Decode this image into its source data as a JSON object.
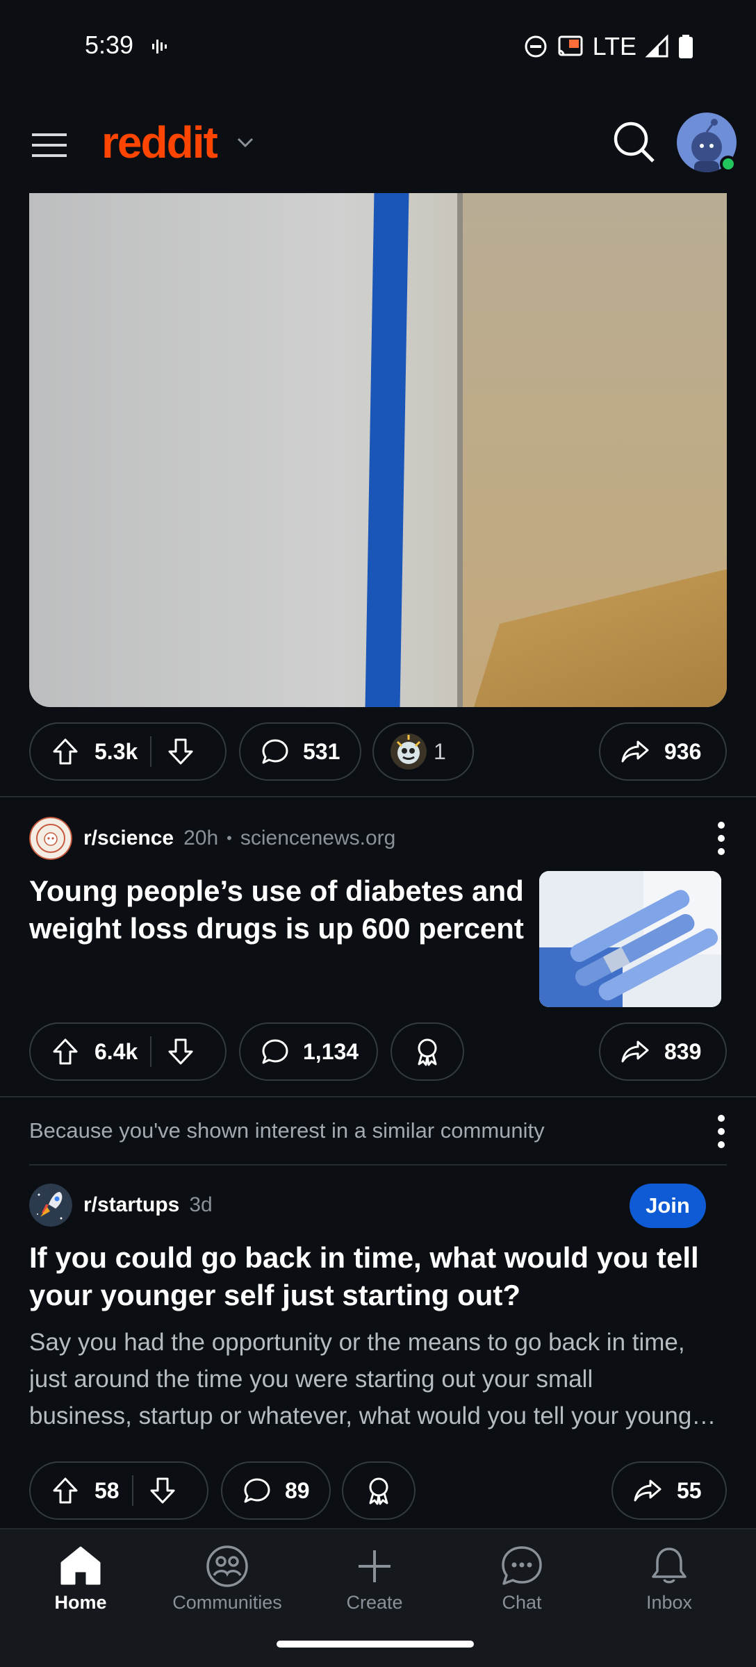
{
  "status_bar": {
    "time": "5:39",
    "network": "LTE"
  },
  "header": {
    "logo": "reddit"
  },
  "post1": {
    "upvotes": "5.3k",
    "comments": "531",
    "awards": "1",
    "shares": "936"
  },
  "post2": {
    "subreddit": "r/science",
    "age": "20h",
    "domain": "sciencenews.org",
    "title_lines": [
      "Young people’s use of diabetes and",
      "weight loss drugs is up 600 percent"
    ],
    "upvotes": "6.4k",
    "comments": "1,134",
    "shares": "839"
  },
  "recommendation": {
    "text": "Because you've shown interest in a similar community"
  },
  "post3": {
    "subreddit": "r/startups",
    "age": "3d",
    "join_label": "Join",
    "title_lines": [
      "If you could go back in time, what would you tell",
      "your younger self just starting out?"
    ],
    "body_lines": [
      "Say you had the opportunity or the means to go back in time,",
      "just around the time you were starting out your small",
      "business, startup or whatever, what would you tell your younger self"
    ],
    "upvotes": "58",
    "comments": "89",
    "shares": "55"
  },
  "bottom_nav": {
    "items": [
      {
        "label": "Home",
        "icon": "home-icon"
      },
      {
        "label": "Communities",
        "icon": "communities-icon"
      },
      {
        "label": "Create",
        "icon": "plus-icon"
      },
      {
        "label": "Chat",
        "icon": "chat-icon"
      },
      {
        "label": "Inbox",
        "icon": "bell-icon"
      }
    ]
  },
  "colors": {
    "brand": "#ff4500",
    "join": "#0f5bd6",
    "background": "#0b0e12"
  }
}
